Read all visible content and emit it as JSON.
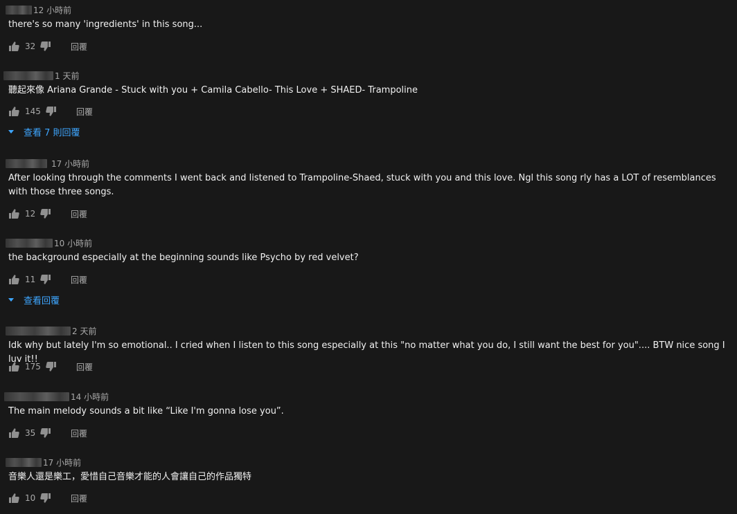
{
  "labels": {
    "reply": "回覆"
  },
  "comments": [
    {
      "time": "12 小時前",
      "text": "there's so many 'ingredients' in this song...",
      "likes": "32"
    },
    {
      "time": "1 天前",
      "text": "聽起來像 Ariana Grande - Stuck with you + Camila Cabello- This Love + SHAED- Trampoline",
      "likes": "145",
      "view_replies": "查看 7 則回覆"
    },
    {
      "time": "17 小時前",
      "text": "After looking through the comments I went back and listened to Trampoline-Shaed, stuck with you and this love. Ngl this song rly has a LOT of resemblances with those three songs.",
      "likes": "12"
    },
    {
      "time": "10 小時前",
      "text": "the background especially at the beginning sounds like Psycho by red velvet?",
      "likes": "11",
      "view_replies": "查看回覆"
    },
    {
      "time": "2 天前",
      "text": "Idk why but lately I'm so emotional.. I cried when I listen to this song especially at this \"no matter what you do, I still want the best for you\".... BTW nice song I luv it!!",
      "likes": "175"
    },
    {
      "time": "14 小時前",
      "text": "The main melody sounds a bit like “Like I'm gonna lose you”.",
      "likes": "35"
    },
    {
      "time": "17 小時前",
      "text": "音樂人還是樂工，愛惜自己音樂才能的人會讓自己的作品獨特",
      "likes": "10"
    }
  ]
}
